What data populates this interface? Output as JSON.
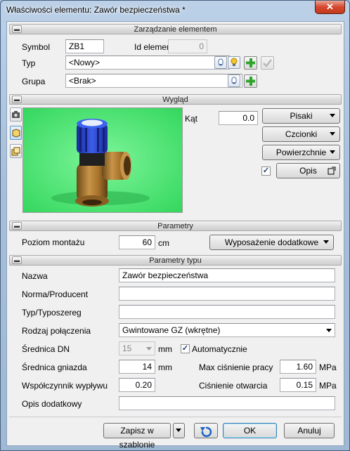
{
  "window": {
    "title": "Właściwości elementu: Zawór bezpieczeństwa *",
    "close_glyph": "✕"
  },
  "sections": {
    "management": "Zarządzanie elementem",
    "appearance": "Wygląd",
    "parameters": "Parametry",
    "type_parameters": "Parametry typu"
  },
  "management": {
    "symbol_label": "Symbol",
    "symbol_value": "ZB1",
    "id_label": "Id elementu",
    "id_value": "0",
    "type_label": "Typ",
    "type_value": "<Nowy>",
    "group_label": "Grupa",
    "group_value": "<Brak>"
  },
  "appearance": {
    "angle_label": "Kąt",
    "angle_value": "0.0",
    "angle_unit": "°",
    "pens_button": "Pisaki",
    "fonts_button": "Czcionki",
    "surfaces_button": "Powierzchnie",
    "description_checked": true,
    "description_button": "Opis",
    "preview_bg": "#3ee66a"
  },
  "parameters": {
    "mount_level_label": "Poziom montażu",
    "mount_level_value": "60",
    "mount_level_unit": "cm",
    "extra_equipment_button": "Wyposażenie dodatkowe"
  },
  "type_params": {
    "name_label": "Nazwa",
    "name_value": "Zawór bezpieczeństwa",
    "standard_label": "Norma/Producent",
    "standard_value": "",
    "series_label": "Typ/Typoszereg",
    "series_value": "",
    "connection_label": "Rodzaj połączenia",
    "connection_value": "Gwintowane GZ (wkrętne)",
    "dn_label": "Średnica DN",
    "dn_value": "15",
    "dn_unit": "mm",
    "auto_checked": true,
    "auto_label": "Automatycznie",
    "seat_label": "Średnica gniazda",
    "seat_value": "14",
    "seat_unit": "mm",
    "max_pressure_label": "Max ciśnienie pracy",
    "max_pressure_value": "1.60",
    "max_pressure_unit": "MPa",
    "flow_coef_label": "Współczynnik wypływu",
    "flow_coef_value": "0.20",
    "open_pressure_label": "Ciśnienie otwarcia",
    "open_pressure_value": "0.15",
    "open_pressure_unit": "MPa",
    "extra_desc_label": "Opis dodatkowy",
    "extra_desc_value": ""
  },
  "footer": {
    "save_template_button": "Zapisz w szablonie",
    "ok_button": "OK",
    "cancel_button": "Anuluj"
  }
}
